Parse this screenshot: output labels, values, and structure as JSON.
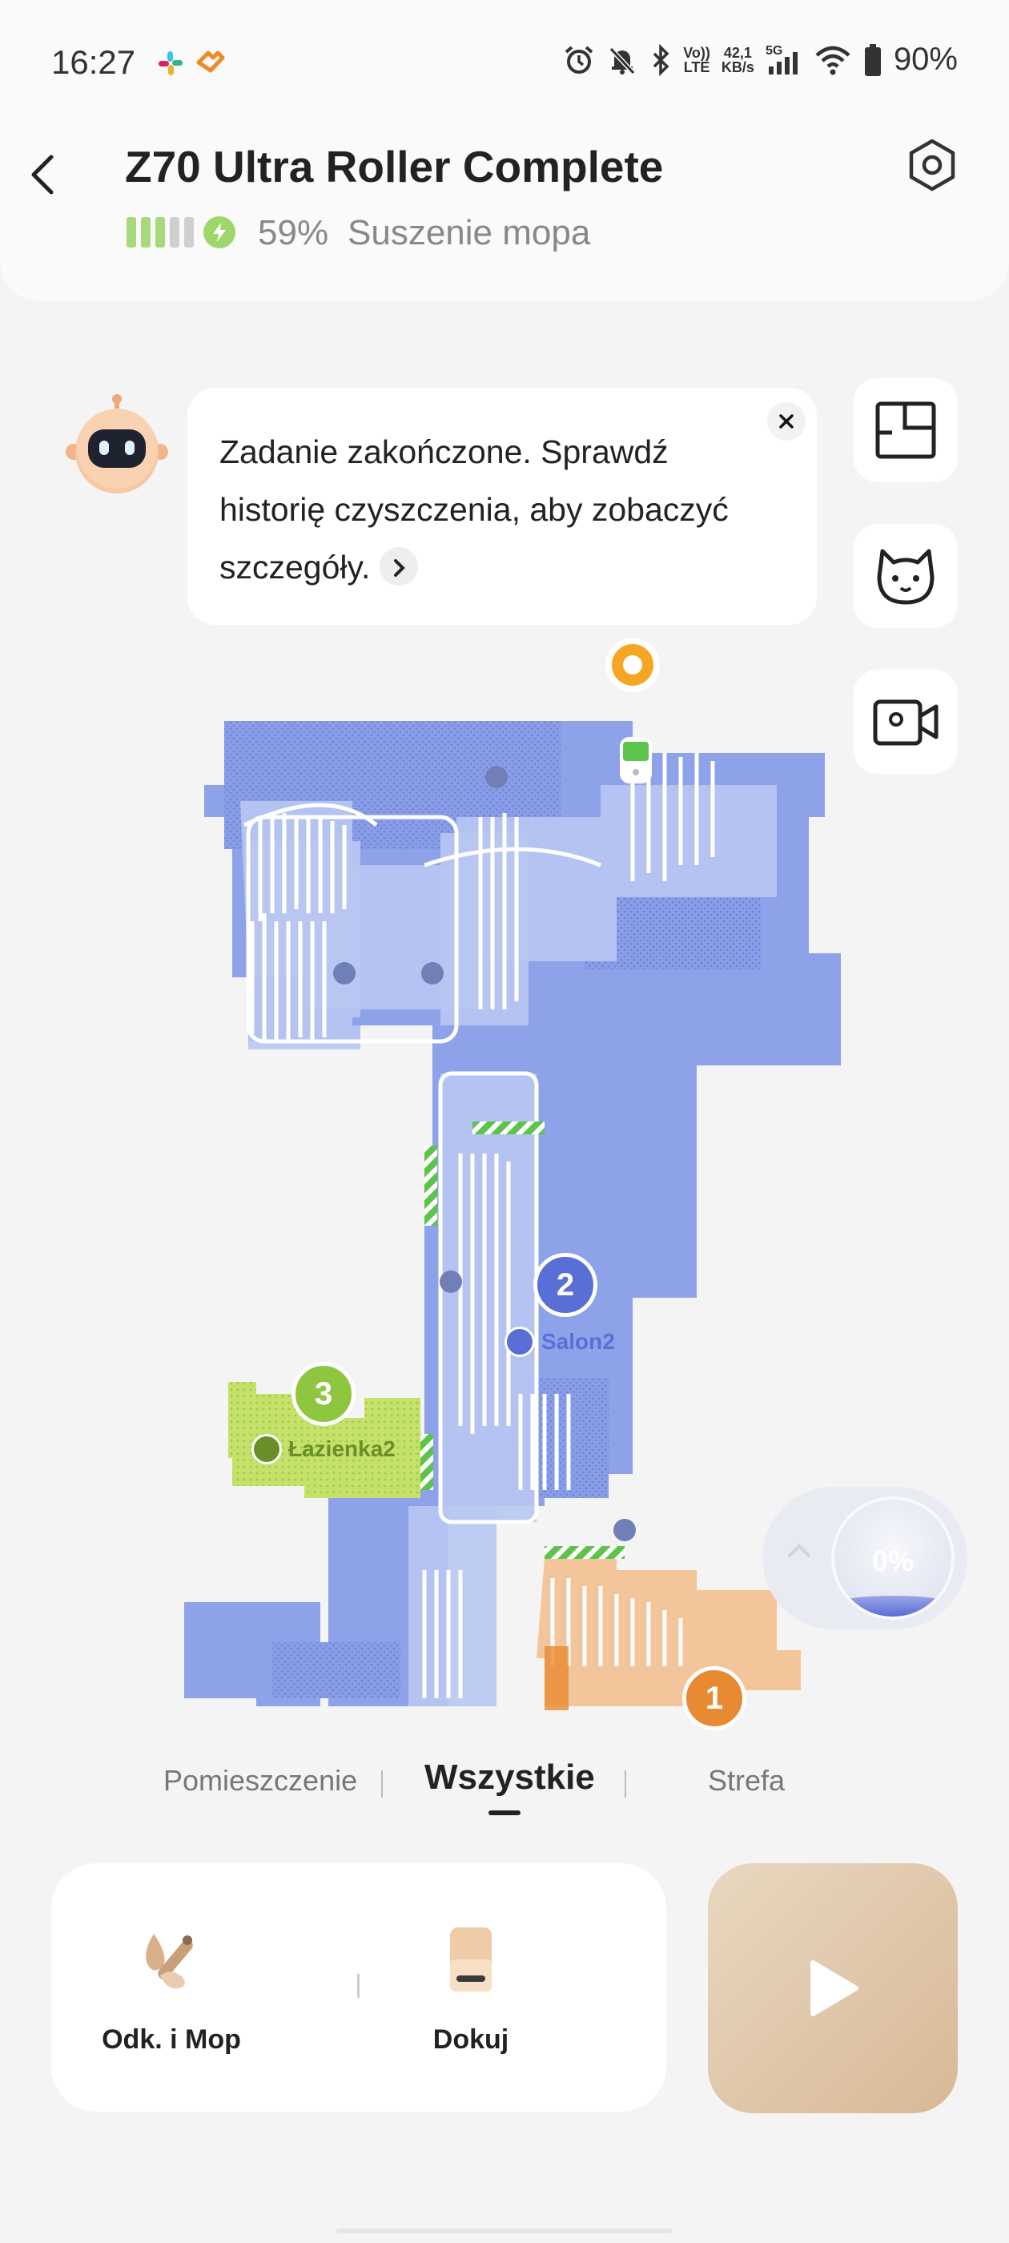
{
  "status_bar": {
    "time": "16:27",
    "volte_label_top": "Vo))",
    "volte_label_bottom": "LTE",
    "speed_top": "42,1",
    "speed_bottom": "KB/s",
    "network_label": "5G",
    "battery": "90%"
  },
  "header": {
    "title": "Z70 Ultra Roller Complete",
    "battery_level": "59%",
    "status": "Suszenie mopa"
  },
  "assistant": {
    "message": "Zadanie zakończone. Sprawdź historię czyszczenia, aby zobaczyć szczegóły."
  },
  "map": {
    "rooms": [
      {
        "number": "1",
        "label": "",
        "color": "#e88a32"
      },
      {
        "number": "2",
        "label": "Salon2",
        "color": "#5a6fd6"
      },
      {
        "number": "3",
        "label": "Łazienka2",
        "color": "#8ec63f"
      }
    ],
    "progress": "0%"
  },
  "tabs": [
    {
      "label": "Pomieszczenie",
      "active": false
    },
    {
      "label": "Wszystkie",
      "active": true
    },
    {
      "label": "Strefa",
      "active": false
    }
  ],
  "actions": {
    "mode_label": "Odk. i Mop",
    "dock_label": "Dokuj"
  },
  "colors": {
    "accent_blue": "#7f95e6",
    "room_green": "#c4e26a",
    "room_orange": "#f2c69a",
    "start_button": "#d8b896"
  }
}
